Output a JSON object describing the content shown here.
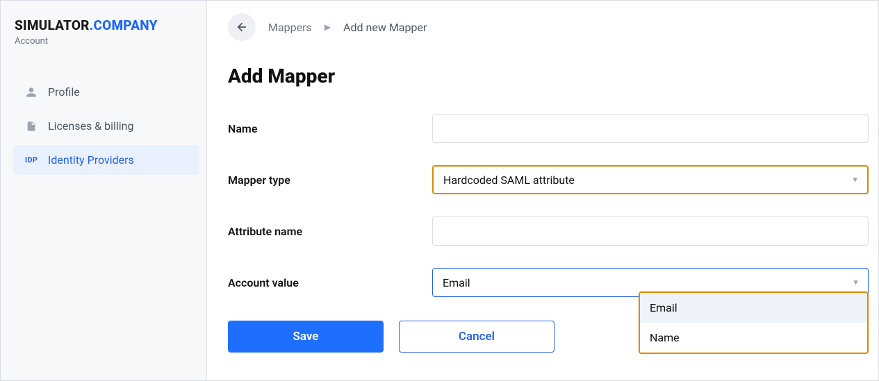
{
  "brand": {
    "part1": "SIMULATOR",
    "part2": ".COMPANY",
    "subtitle": "Account"
  },
  "sidebar": {
    "items": [
      {
        "label": "Profile",
        "icon": "user-icon",
        "active": false
      },
      {
        "label": "Licenses & billing",
        "icon": "file-icon",
        "active": false
      },
      {
        "label": "Identity Providers",
        "icon": "idp-badge",
        "badge": "IDP",
        "active": true
      }
    ]
  },
  "breadcrumbs": {
    "back_aria": "Back",
    "link": "Mappers",
    "current": "Add new Mapper"
  },
  "page": {
    "title": "Add Mapper"
  },
  "form": {
    "name": {
      "label": "Name",
      "value": ""
    },
    "mapper_type": {
      "label": "Mapper type",
      "value": "Hardcoded SAML attribute"
    },
    "attribute_name": {
      "label": "Attribute name",
      "value": ""
    },
    "account_value": {
      "label": "Account value",
      "value": "Email",
      "options": [
        "Email",
        "Name"
      ],
      "highlighted": "Email"
    }
  },
  "buttons": {
    "save": "Save",
    "cancel": "Cancel"
  },
  "colors": {
    "accent": "#1f6fff",
    "focus_orange": "#e08a00",
    "link_blue": "#2563eb"
  }
}
